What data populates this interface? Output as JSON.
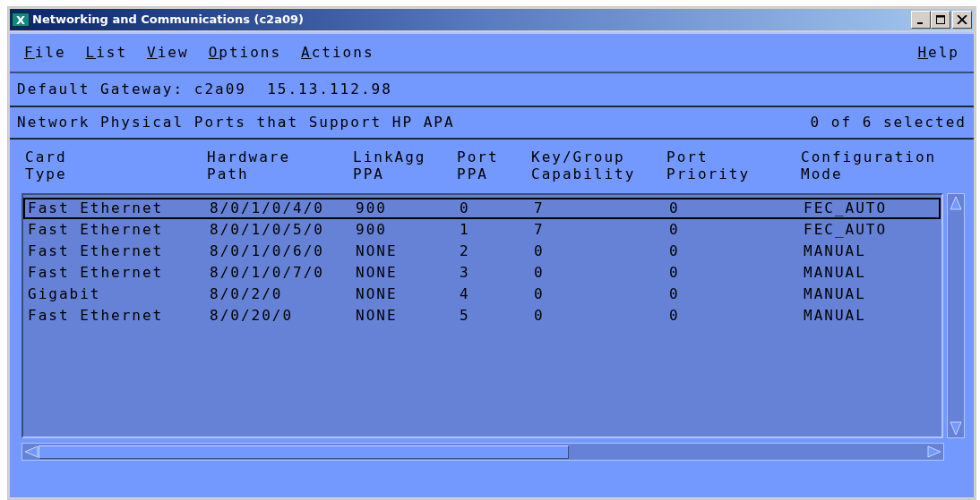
{
  "window": {
    "title": "Networking and Communications (c2a09)",
    "icon": "X"
  },
  "menu": {
    "left": [
      "File",
      "List",
      "View",
      "Options",
      "Actions"
    ],
    "right": [
      "Help"
    ]
  },
  "gateway": "Default Gateway: c2a09  15.13.112.98",
  "section": {
    "title": "Network Physical Ports that Support HP APA",
    "count": "0 of 6 selected"
  },
  "table": {
    "columns": [
      "Card\nType",
      "Hardware\nPath",
      "LinkAgg\nPPA",
      "Port\nPPA",
      "Key/Group\nCapability",
      "Port\nPriority",
      "Configuration\nMode"
    ],
    "rows": [
      {
        "focused": true,
        "cells": [
          "Fast Ethernet",
          "8/0/1/0/4/0",
          "900",
          "0",
          "7",
          "0",
          "FEC_AUTO"
        ]
      },
      {
        "focused": false,
        "cells": [
          "Fast Ethernet",
          "8/0/1/0/5/0",
          "900",
          "1",
          "7",
          "0",
          "FEC_AUTO"
        ]
      },
      {
        "focused": false,
        "cells": [
          "Fast Ethernet",
          "8/0/1/0/6/0",
          "NONE",
          "2",
          "0",
          "0",
          "MANUAL"
        ]
      },
      {
        "focused": false,
        "cells": [
          "Fast Ethernet",
          "8/0/1/0/7/0",
          "NONE",
          "3",
          "0",
          "0",
          "MANUAL"
        ]
      },
      {
        "focused": false,
        "cells": [
          "Gigabit",
          "8/0/2/0",
          "NONE",
          "4",
          "0",
          "0",
          "MANUAL"
        ]
      },
      {
        "focused": false,
        "cells": [
          "Fast Ethernet",
          "8/0/20/0",
          "NONE",
          "5",
          "0",
          "0",
          "MANUAL"
        ]
      }
    ]
  }
}
